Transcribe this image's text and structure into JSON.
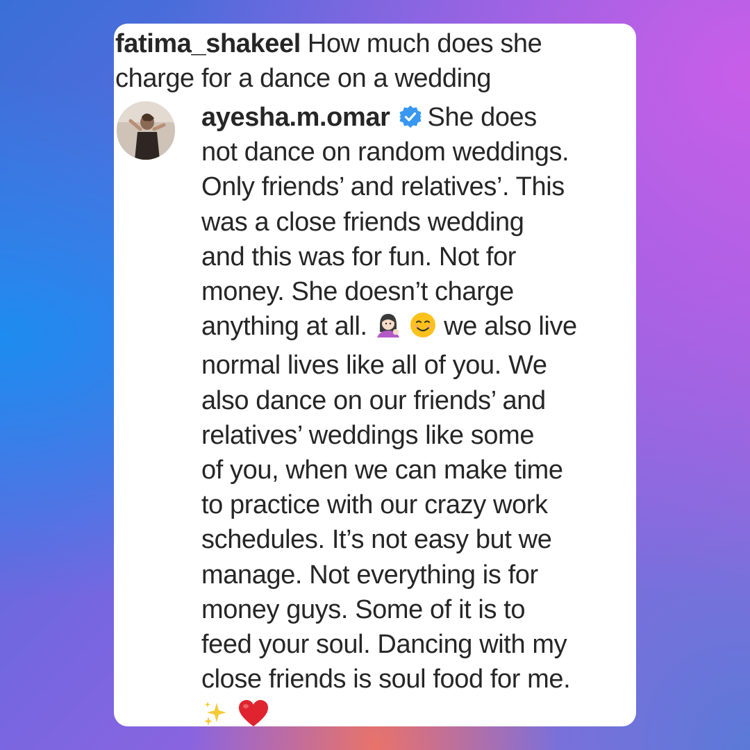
{
  "question": {
    "username": "fatima_shakeel",
    "line1": "How much does she",
    "line2": "charge for a dance on  a wedding"
  },
  "reply": {
    "username": "ayesha.m.omar",
    "verified": true,
    "first_text": "She does",
    "lines": [
      "not dance on random weddings.",
      "Only friends’ and relatives’. This",
      "was a close friends wedding",
      "and this was for fun. Not for",
      "money. She doesn’t charge",
      "anything at all.",
      "normal lives like all of you. We",
      "also dance on our friends’ and",
      "relatives’ weddings like some",
      "of you, when we can make time",
      "to practice with our crazy work",
      "schedules. It’s not easy but we",
      "manage. Not everything is for",
      "money guys. Some of it is to",
      "feed your soul. Dancing with my",
      "close friends is soul food for me."
    ],
    "emoji_line_suffix": "we also live",
    "inline_emojis": [
      "woman-tipping-hand-icon",
      "smiling-face-icon"
    ],
    "trailing_emojis": [
      "sparkles-icon",
      "red-heart-icon"
    ]
  },
  "colors": {
    "text": "#262626",
    "verified_badge": "#3897f0",
    "heart": "#e0242f",
    "sparkles": "#f6c937"
  }
}
